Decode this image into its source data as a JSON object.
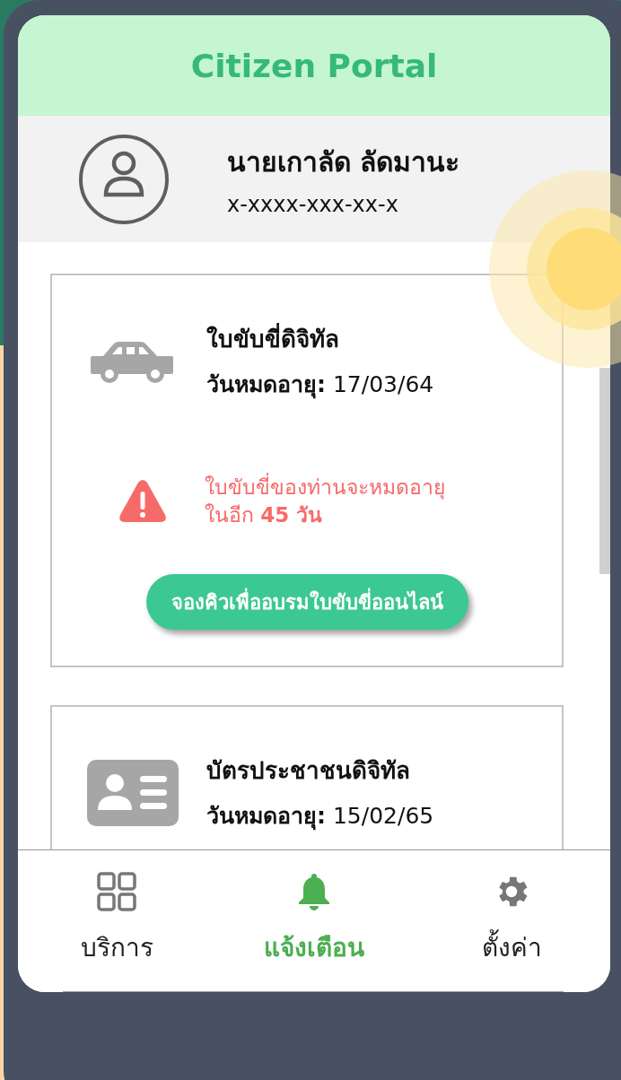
{
  "header": {
    "title": "Citizen Portal"
  },
  "profile": {
    "name": "นายเกาลัด ลัดมานะ",
    "citizen_id": "x-xxxx-xxx-xx-x"
  },
  "cards": [
    {
      "kind": "license",
      "title": "ใบขับขี่ดิจิทัล",
      "expiry": "**วันหมดอายุ:** 17/03/64",
      "warning": {
        "text": "ใบขับขี่ของท่านจะหมดอายุ\nในอีก **45 วัน**",
        "button": "จองคิวเพื่ออบรมใบขับขี่ออนไลน์"
      }
    },
    {
      "kind": "id_card",
      "title": "บัตรประชาชนดิจิทัล",
      "expiry": "**วันหมดอายุ:** 15/02/65"
    }
  ],
  "nav": [
    {
      "kind": "services",
      "label": "บริการ",
      "selected": false
    },
    {
      "kind": "alerts",
      "label": "แจ้งเตือน",
      "selected": true
    },
    {
      "kind": "settings",
      "label": "ตั้งค่า",
      "selected": false
    }
  ]
}
